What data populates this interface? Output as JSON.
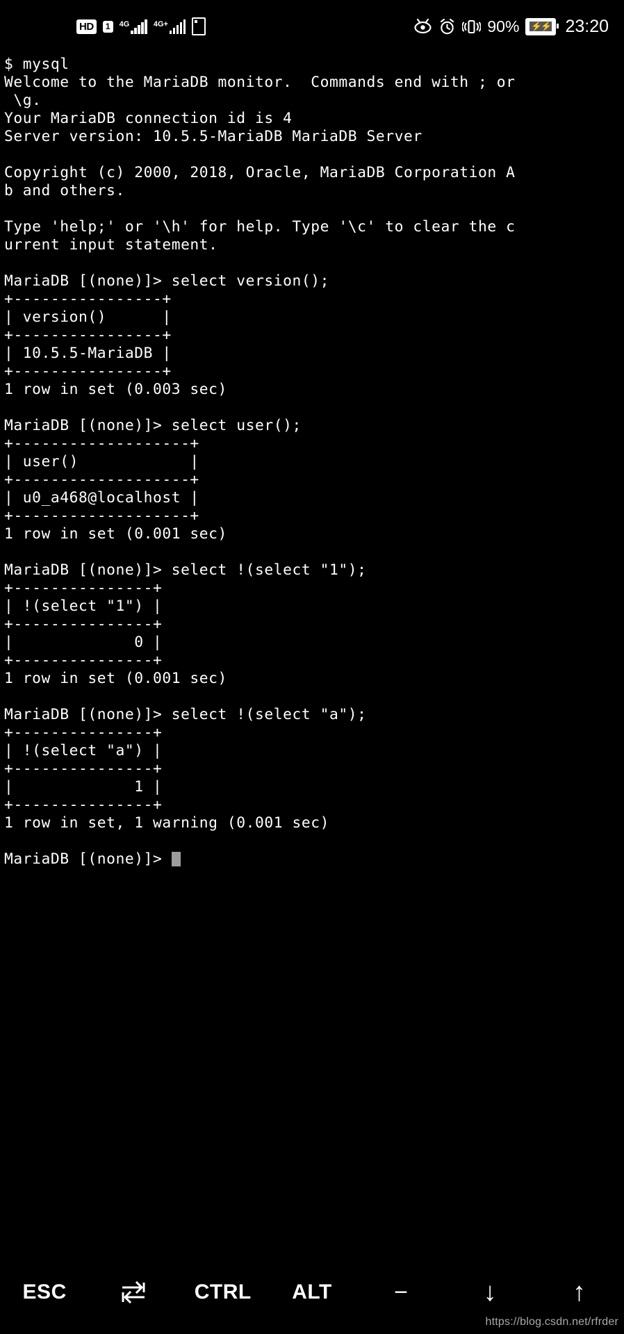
{
  "status_bar": {
    "hd_label": "HD",
    "sim_label": "1",
    "network_1_label": "4G",
    "network_2_label": "4G+",
    "battery_percent": "90%",
    "clock": "23:20"
  },
  "terminal": {
    "prompt_shell": "$ ",
    "command_shell": "mysql",
    "lines": [
      "$ mysql",
      "Welcome to the MariaDB monitor.  Commands end with ; or",
      " \\g.",
      "Your MariaDB connection id is 4",
      "Server version: 10.5.5-MariaDB MariaDB Server",
      "",
      "Copyright (c) 2000, 2018, Oracle, MariaDB Corporation A",
      "b and others.",
      "",
      "Type 'help;' or '\\h' for help. Type '\\c' to clear the c",
      "urrent input statement.",
      "",
      "MariaDB [(none)]> select version();",
      "+----------------+",
      "| version()      |",
      "+----------------+",
      "| 10.5.5-MariaDB |",
      "+----------------+",
      "1 row in set (0.003 sec)",
      "",
      "MariaDB [(none)]> select user();",
      "+-------------------+",
      "| user()            |",
      "+-------------------+",
      "| u0_a468@localhost |",
      "+-------------------+",
      "1 row in set (0.001 sec)",
      "",
      "MariaDB [(none)]> select !(select \"1\");",
      "+---------------+",
      "| !(select \"1\") |",
      "+---------------+",
      "|             0 |",
      "+---------------+",
      "1 row in set (0.001 sec)",
      "",
      "MariaDB [(none)]> select !(select \"a\");",
      "+---------------+",
      "| !(select \"a\") |",
      "+---------------+",
      "|             1 |",
      "+---------------+",
      "1 row in set, 1 warning (0.001 sec)",
      ""
    ],
    "final_prompt": "MariaDB [(none)]> ",
    "queries": [
      {
        "sql": "select version();",
        "columns": [
          "version()"
        ],
        "rows": [
          [
            "10.5.5-MariaDB"
          ]
        ],
        "status": "1 row in set (0.003 sec)"
      },
      {
        "sql": "select user();",
        "columns": [
          "user()"
        ],
        "rows": [
          [
            "u0_a468@localhost"
          ]
        ],
        "status": "1 row in set (0.001 sec)"
      },
      {
        "sql": "select !(select \"1\");",
        "columns": [
          "!(select \"1\")"
        ],
        "rows": [
          [
            "0"
          ]
        ],
        "status": "1 row in set (0.001 sec)"
      },
      {
        "sql": "select !(select \"a\");",
        "columns": [
          "!(select \"a\")"
        ],
        "rows": [
          [
            "1"
          ]
        ],
        "status": "1 row in set, 1 warning (0.001 sec)"
      }
    ],
    "banner": {
      "welcome": "Welcome to the MariaDB monitor.  Commands end with ; or \\g.",
      "connection_id": "Your MariaDB connection id is 4",
      "server_version": "Server version: 10.5.5-MariaDB MariaDB Server",
      "copyright": "Copyright (c) 2000, 2018, Oracle, MariaDB Corporation Ab and others.",
      "help_hint": "Type 'help;' or '\\h' for help. Type '\\c' to clear the current input statement."
    }
  },
  "key_bar": {
    "keys": [
      {
        "label": "ESC",
        "icon": "escape-key"
      },
      {
        "label": "",
        "icon": "tab-key"
      },
      {
        "label": "CTRL",
        "icon": "control-key"
      },
      {
        "label": "ALT",
        "icon": "alt-key"
      },
      {
        "label": "−",
        "icon": "minus-key"
      },
      {
        "label": "↓",
        "icon": "arrow-down-key"
      },
      {
        "label": "↑",
        "icon": "arrow-up-key"
      }
    ]
  },
  "watermark": {
    "text": "https://blog.csdn.net/rfrder"
  },
  "colors": {
    "background": "#000000",
    "foreground": "#ffffff",
    "cursor": "#9d9d9d",
    "watermark": "#b9b9b9"
  }
}
